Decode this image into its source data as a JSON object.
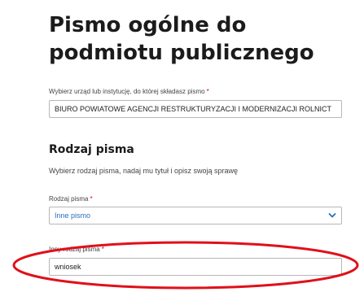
{
  "page": {
    "title": "Pismo ogólne do podmiotu publicznego"
  },
  "institution": {
    "label": "Wybierz urząd lub instytucję, do której składasz pismo",
    "required_mark": "*",
    "value": "BIURO POWIATOWE AGENCJI RESTRUKTURYZACJI I MODERNIZACJI ROLNICT"
  },
  "letter_type_section": {
    "title": "Rodzaj pisma",
    "description": "Wybierz rodzaj pisma, nadaj mu tytuł i opisz swoją sprawę"
  },
  "letter_type": {
    "label": "Rodzaj pisma",
    "required_mark": "*",
    "selected": "Inne pismo",
    "icon": "chevron-down-icon"
  },
  "other_type": {
    "label": "Inny rodzaj pisma",
    "required_mark": "*",
    "value": "wniosek"
  },
  "colors": {
    "annotation": "#e0101a",
    "link_blue": "#2a6ebb",
    "required": "#d0021b"
  }
}
